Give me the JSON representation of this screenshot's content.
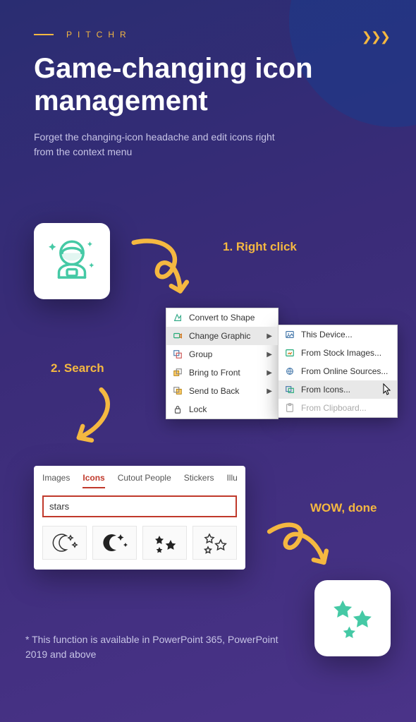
{
  "brand": "PITCHR",
  "title": "Game-changing icon management",
  "subtitle": "Forget the changing-icon headache and edit icons right from the context menu",
  "steps": {
    "s1": "1. Right click",
    "s2": "2. Search",
    "s3": "WOW, done"
  },
  "context_menu": {
    "left": [
      {
        "label": "Convert to Shape",
        "caret": false
      },
      {
        "label": "Change Graphic",
        "caret": true,
        "hover": true
      },
      {
        "label": "Group",
        "caret": true
      },
      {
        "label": "Bring to Front",
        "caret": true
      },
      {
        "label": "Send to Back",
        "caret": true
      },
      {
        "label": "Lock",
        "caret": false
      }
    ],
    "right": [
      {
        "label": "This Device..."
      },
      {
        "label": "From Stock Images..."
      },
      {
        "label": "From Online Sources..."
      },
      {
        "label": "From Icons...",
        "hover": true
      },
      {
        "label": "From Clipboard...",
        "disabled": true
      }
    ]
  },
  "search_panel": {
    "tabs": [
      "Images",
      "Icons",
      "Cutout People",
      "Stickers",
      "Illust"
    ],
    "active_tab_index": 1,
    "search_value": "stars"
  },
  "footnote": "* This function is available in PowerPoint 365, PowerPoint 2019 and above"
}
